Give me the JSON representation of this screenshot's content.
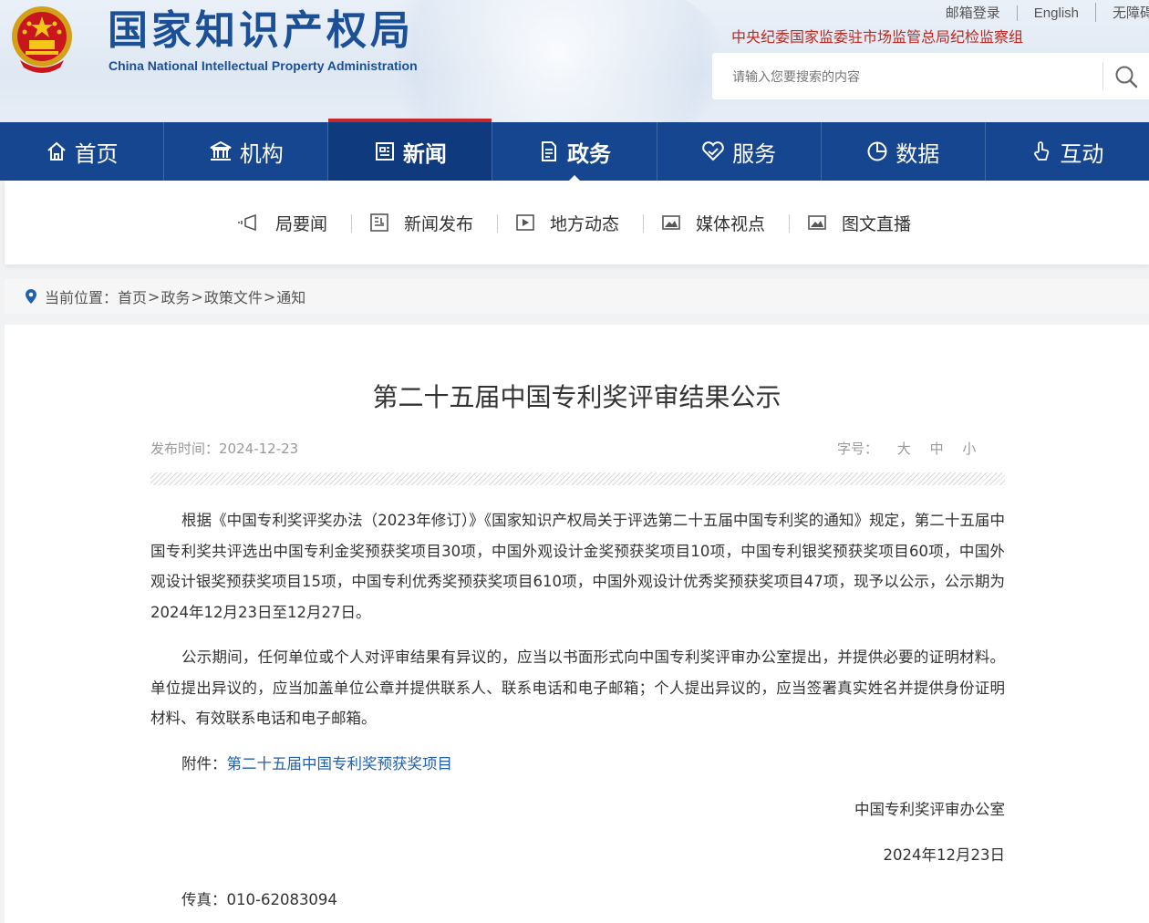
{
  "header": {
    "org_name_cn": "国家知识产权局",
    "org_name_en": "China National Intellectual Property Administration",
    "top_links": [
      "邮箱登录",
      "English",
      "无障碍"
    ],
    "red_link": "中央纪委国家监委驻市场监管总局纪检监察组",
    "search": {
      "placeholder": "请输入您要搜索的内容"
    }
  },
  "nav": {
    "items": [
      {
        "label": "首页",
        "icon": "home-icon"
      },
      {
        "label": "机构",
        "icon": "institution-icon"
      },
      {
        "label": "新闻",
        "icon": "news-icon"
      },
      {
        "label": "政务",
        "icon": "government-affairs-icon"
      },
      {
        "label": "服务",
        "icon": "service-icon"
      },
      {
        "label": "数据",
        "icon": "data-icon"
      },
      {
        "label": "互动",
        "icon": "interaction-icon"
      }
    ]
  },
  "subnav": {
    "items": [
      {
        "label": "局要闻",
        "icon": "megaphone-icon"
      },
      {
        "label": "新闻发布",
        "icon": "document-icon"
      },
      {
        "label": "地方动态",
        "icon": "video-icon"
      },
      {
        "label": "媒体视点",
        "icon": "image-icon"
      },
      {
        "label": "图文直播",
        "icon": "image-icon"
      }
    ]
  },
  "breadcrumb": {
    "prefix": "当前位置：",
    "items": [
      "首页",
      "政务",
      "政策文件",
      "通知"
    ]
  },
  "article": {
    "title": "第二十五届中国专利奖评审结果公示",
    "publish_label": "发布时间：",
    "publish_date": "2024-12-23",
    "font_size_label": "字号：",
    "font_sizes": [
      "大",
      "中",
      "小"
    ],
    "paragraphs": [
      "根据《中国专利奖评奖办法（2023年修订）》《国家知识产权局关于评选第二十五届中国专利奖的通知》规定，第二十五届中国专利奖共评选出中国专利金奖预获奖项目30项，中国外观设计金奖预获奖项目10项，中国专利银奖预获奖项目60项，中国外观设计银奖预获奖项目15项，中国专利优秀奖预获奖项目610项，中国外观设计优秀奖预获奖项目47项，现予以公示，公示期为2024年12月23日至12月27日。",
      "公示期间，任何单位或个人对评审结果有异议的，应当以书面形式向中国专利奖评审办公室提出，并提供必要的证明材料。单位提出异议的，应当加盖单位公章并提供联系人、联系电话和电子邮箱；个人提出异议的，应当签署真实姓名并提供身份证明材料、有效联系电话和电子邮箱。"
    ],
    "attachment_label": "附件：",
    "attachment_link": "第二十五届中国专利奖预获奖项目",
    "signature": "中国专利奖评审办公室",
    "sign_date": "2024年12月23日",
    "fax_label": "传真：",
    "fax": "010-62083094"
  },
  "colors": {
    "nav_bg": "#16468f",
    "nav_active_bg": "#0f3a7e",
    "active_top_bar": "#c8272c",
    "logo_blue": "#1b4f96",
    "red_link": "#c0271f",
    "link_blue": "#1f5fad"
  }
}
